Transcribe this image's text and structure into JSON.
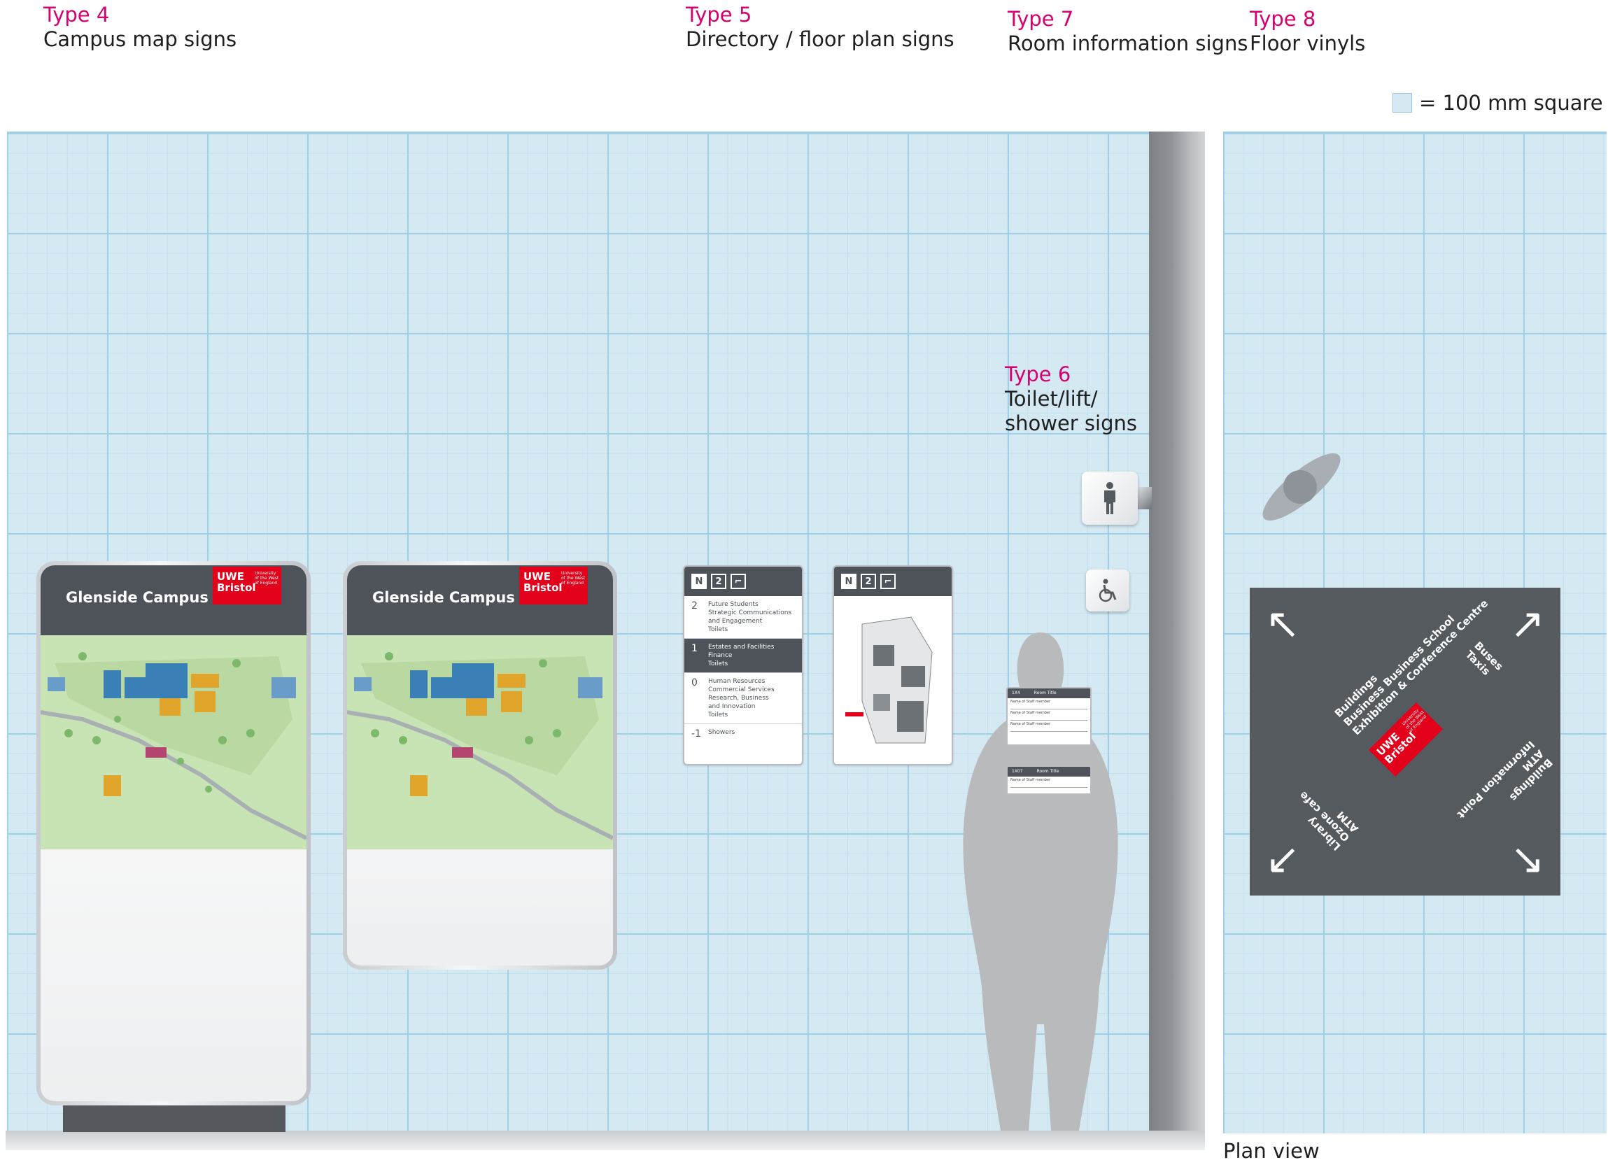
{
  "labels": {
    "type4": {
      "title": "Type 4",
      "desc": "Campus map signs"
    },
    "type5": {
      "title": "Type 5",
      "desc": "Directory / floor plan signs"
    },
    "type6": {
      "title": "Type 6",
      "desc1": "Toilet/lift/",
      "desc2": "shower signs"
    },
    "type7": {
      "title": "Type 7",
      "desc": "Room information signs"
    },
    "type8": {
      "title": "Type 8",
      "desc": "Floor vinyls"
    }
  },
  "legend": {
    "text": "= 100 mm square"
  },
  "plan_caption": "Plan view",
  "campus_sign": {
    "title": "Glenside Campus",
    "logo_main": "UWE Bristol",
    "logo_sub": "University of the West of England"
  },
  "directory": {
    "chips": [
      "N",
      "2"
    ],
    "rows": [
      {
        "num": "2",
        "lines": [
          "Future Students",
          "Strategic Communications",
          "and Engagement",
          "Toilets"
        ]
      },
      {
        "num": "1",
        "lines": [
          "Estates and Facilities",
          "Finance",
          "Toilets"
        ]
      },
      {
        "num": "0",
        "lines": [
          "Human Resources",
          "Commercial Services",
          "Research, Business",
          "and Innovation",
          "Toilets"
        ]
      },
      {
        "num": "-1",
        "lines": [
          "Showers"
        ]
      }
    ]
  },
  "room_sign": {
    "a": {
      "number": "1X4",
      "title": "Room Title"
    },
    "b": {
      "number": "1X07",
      "title": "Room Title"
    },
    "staff": "Name of Staff member"
  },
  "vinyl": {
    "nw": "Buildings",
    "nw2": "Business Business School",
    "nw3": "Exhibition & Conference Centre",
    "ne1": "Buses",
    "ne2": "Taxis",
    "sw1": "Library",
    "sw2": "Ozone cafe",
    "sw3": "ATM",
    "se1": "Buildings",
    "se2": "ATM",
    "se3": "Information Point"
  },
  "colors": {
    "accent": "#d6006e",
    "brand_red": "#e2001a",
    "sign_grey": "#4d5358",
    "grid": "#d5e9f2"
  }
}
